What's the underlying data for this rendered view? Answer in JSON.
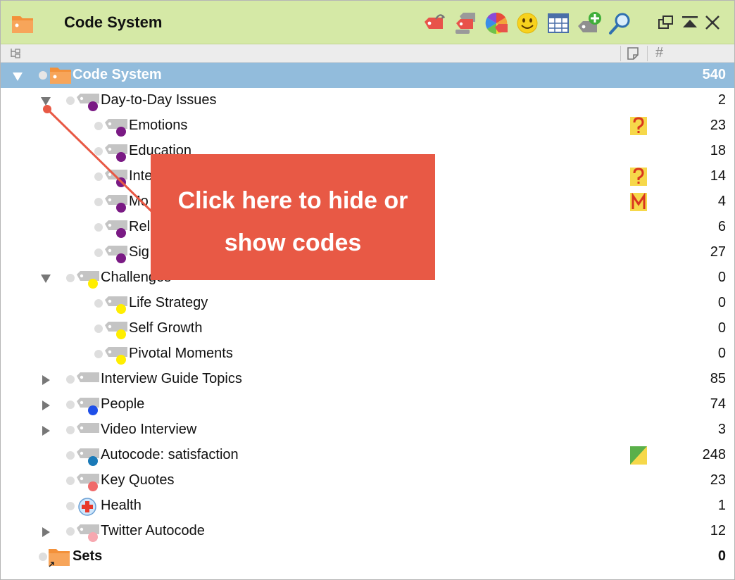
{
  "window": {
    "title": "Code System"
  },
  "toolbar": {
    "buttons": [
      {
        "name": "import-codes-button",
        "icon": "tag-arrow-icon"
      },
      {
        "name": "code-configuration-button",
        "icon": "tags-icon"
      },
      {
        "name": "code-colors-button",
        "icon": "color-wheel-icon"
      },
      {
        "name": "emoticode-button",
        "icon": "smiley-icon"
      },
      {
        "name": "code-matrix-button",
        "icon": "table-grid-icon"
      },
      {
        "name": "new-code-button",
        "icon": "tag-plus-icon"
      },
      {
        "name": "search-button",
        "icon": "magnifier-icon"
      }
    ],
    "window_controls": [
      {
        "name": "undock-button",
        "icon": "undock-icon"
      },
      {
        "name": "collapse-button",
        "icon": "collapse-icon"
      },
      {
        "name": "close-button",
        "icon": "close-icon"
      }
    ]
  },
  "columns": {
    "memo_symbol": "memo",
    "count_symbol": "#"
  },
  "tree": {
    "root": {
      "label": "Code System",
      "count": "540"
    },
    "rows": [
      {
        "label": "Day-to-Day Issues",
        "count": "2",
        "level": 1,
        "toggle": "open",
        "color": "#7a1a84",
        "memo": ""
      },
      {
        "label": "Emotions",
        "count": "23",
        "level": 2,
        "toggle": "",
        "color": "#7a1a84",
        "memo": "?"
      },
      {
        "label": "Education",
        "count": "18",
        "level": 2,
        "toggle": "",
        "color": "#7a1a84",
        "memo": ""
      },
      {
        "label": "Inte",
        "count": "14",
        "level": 2,
        "toggle": "",
        "color": "#7a1a84",
        "memo": "?"
      },
      {
        "label": "Mo",
        "count": "4",
        "level": 2,
        "toggle": "",
        "color": "#7a1a84",
        "memo": "M"
      },
      {
        "label": "Rel",
        "count": "6",
        "level": 2,
        "toggle": "",
        "color": "#7a1a84",
        "memo": ""
      },
      {
        "label": "Sig",
        "count": "27",
        "level": 2,
        "toggle": "",
        "color": "#7a1a84",
        "memo": ""
      },
      {
        "label": "Challenges",
        "count": "0",
        "level": 1,
        "toggle": "open",
        "color": "#ffee00",
        "memo": ""
      },
      {
        "label": "Life Strategy",
        "count": "0",
        "level": 2,
        "toggle": "",
        "color": "#ffee00",
        "memo": ""
      },
      {
        "label": "Self Growth",
        "count": "0",
        "level": 2,
        "toggle": "",
        "color": "#ffee00",
        "memo": ""
      },
      {
        "label": "Pivotal Moments",
        "count": "0",
        "level": 2,
        "toggle": "",
        "color": "#ffee00",
        "memo": ""
      },
      {
        "label": "Interview Guide Topics",
        "count": "85",
        "level": 1,
        "toggle": "closed",
        "color": "",
        "memo": ""
      },
      {
        "label": "People",
        "count": "74",
        "level": 1,
        "toggle": "closed",
        "color": "#1f4fe8",
        "memo": ""
      },
      {
        "label": "Video Interview",
        "count": "3",
        "level": 1,
        "toggle": "closed",
        "color": "",
        "memo": ""
      },
      {
        "label": "Autocode: satisfaction",
        "count": "248",
        "level": 1,
        "toggle": "",
        "color": "#1a7ab8",
        "memo": "green"
      },
      {
        "label": "Key Quotes",
        "count": "23",
        "level": 1,
        "toggle": "",
        "color": "#f06a6a",
        "memo": ""
      },
      {
        "label": "Health",
        "count": "1",
        "level": 1,
        "toggle": "",
        "color": "health",
        "memo": ""
      },
      {
        "label": "Twitter Autocode",
        "count": "12",
        "level": 1,
        "toggle": "closed",
        "color": "#f7a8b0",
        "memo": ""
      }
    ],
    "sets": {
      "label": "Sets",
      "count": "0"
    }
  },
  "callout": {
    "line1": "Click here to hide or",
    "line2": "show codes"
  },
  "colors": {
    "titlebar": "#d5e9a6",
    "selection": "#92bcdc",
    "callout": "#e85945",
    "memo_yellow": "#f6d84a",
    "memo_letter": "#d9361e"
  }
}
